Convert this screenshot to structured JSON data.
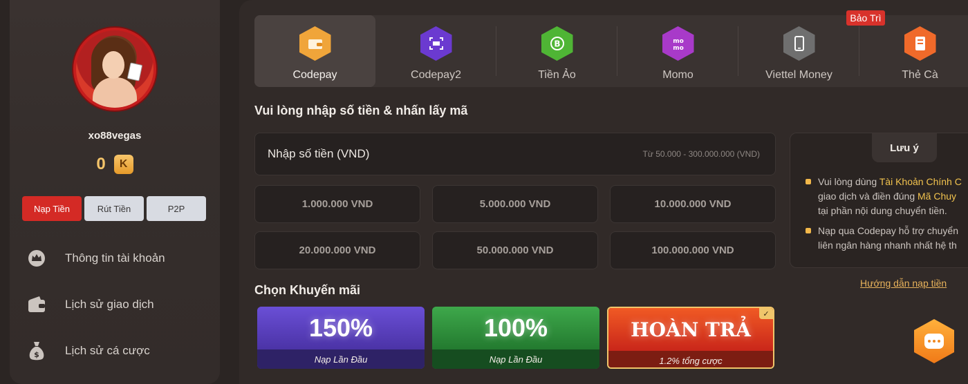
{
  "sidebar": {
    "username": "xo88vegas",
    "balance": "0",
    "coin_icon_letter": "K",
    "wallet_tabs": [
      {
        "label": "Nạp Tiền",
        "active": true
      },
      {
        "label": "Rút Tiền",
        "active": false
      },
      {
        "label": "P2P",
        "active": false
      }
    ],
    "menu": [
      {
        "label": "Thông tin tài khoản",
        "icon": "crown-icon"
      },
      {
        "label": "Lịch sử giao dịch",
        "icon": "wallet-icon"
      },
      {
        "label": "Lịch sử cá cược",
        "icon": "money-bag-icon"
      }
    ]
  },
  "methods": [
    {
      "label": "Codepay",
      "icon": "wallet-icon",
      "color": "#f0a53a",
      "active": true
    },
    {
      "label": "Codepay2",
      "icon": "scan-icon",
      "color": "#6b3ad0",
      "active": false
    },
    {
      "label": "Tiền Ảo",
      "icon": "bitcoin-icon",
      "color": "#4fb535",
      "active": false
    },
    {
      "label": "Momo",
      "icon": "momo-icon",
      "color": "#a83ac9",
      "active": false
    },
    {
      "label": "Viettel Money",
      "icon": "phone-icon",
      "color": "#6f6f6f",
      "active": false
    },
    {
      "label": "Thẻ Cà",
      "icon": "card-icon",
      "color": "#f06a2a",
      "active": false
    }
  ],
  "maintenance_badge": "Bảo Trì",
  "amount_section": {
    "title": "Vui lòng nhập số tiền & nhấn lấy mã",
    "input_label": "Nhập số tiền (VND)",
    "range_text": "Từ 50.000 - 300.000.000 (VND)",
    "amounts": [
      "1.000.000 VND",
      "5.000.000 VND",
      "10.000.000 VND",
      "20.000.000 VND",
      "50.000.000 VND",
      "100.000.000 VND"
    ]
  },
  "note": {
    "title": "Lưu ý",
    "item1_pre": "Vui lòng dùng ",
    "item1_hl1": "Tài Khoản Chính C",
    "item1_mid": "giao dịch và điền đúng ",
    "item1_hl2": "Mã Chuy",
    "item1_post": "tại phần nội dung chuyển tiền.",
    "item2_line1": "Nạp qua Codepay hỗ trợ chuyển",
    "item2_line2": "liên ngân hàng nhanh nhất hệ th"
  },
  "guide_link": "Hướng dẫn nạp tiền",
  "promo_section": {
    "title": "Chọn Khuyến mãi",
    "promos": [
      {
        "big": "150%",
        "sub": "Nạp Lần Đầu"
      },
      {
        "big": "100%",
        "sub": "Nạp Lần Đầu"
      },
      {
        "big": "HOÀN TRẢ",
        "sub": "1.2% tổng cược",
        "selected": true
      }
    ]
  },
  "colors": {
    "accent_red": "#d42a25",
    "accent_gold": "#f2c34e",
    "background": "#2b2523"
  }
}
